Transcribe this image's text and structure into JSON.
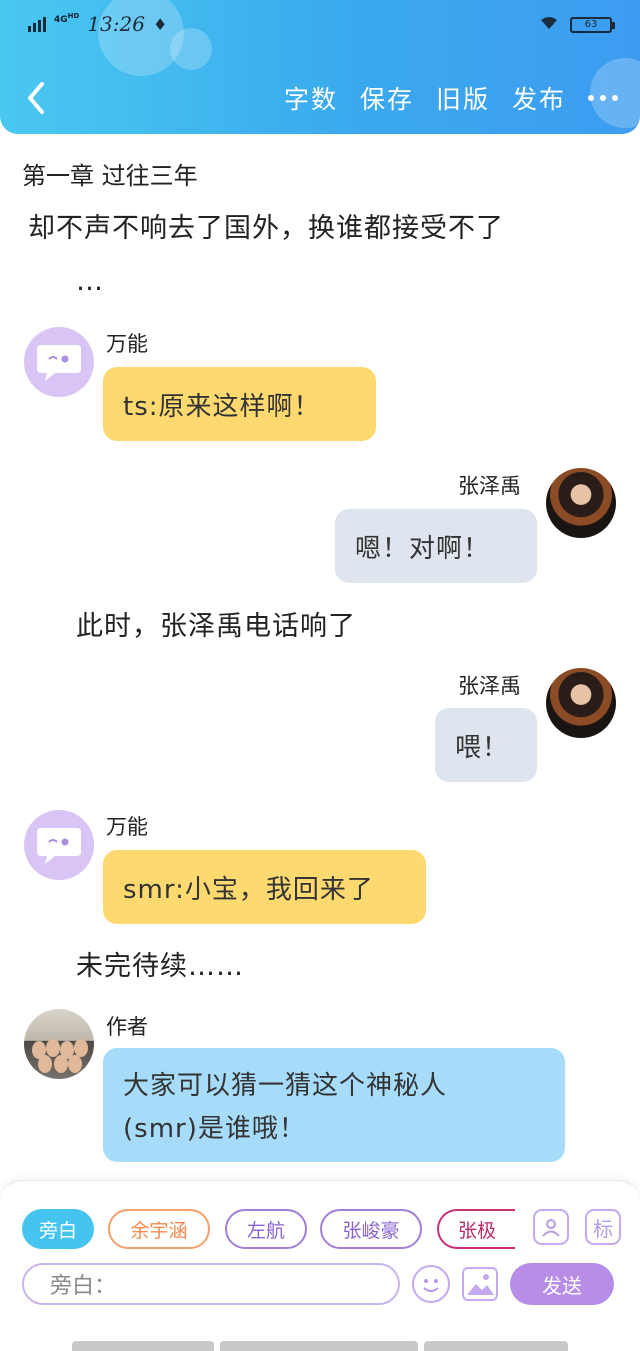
{
  "status": {
    "network": "4G",
    "network_sup": "HD",
    "time": "13:26",
    "wechat_icon": "wechat-icon",
    "battery": "63"
  },
  "toolbar": {
    "word_count": "字数",
    "save": "保存",
    "old_version": "旧版",
    "publish": "发布"
  },
  "story": {
    "chapter_title": "第一章 过往三年",
    "line1": "却不声不响去了国外，换谁都接受不了",
    "line2": "…",
    "line3": "此时，张泽禹电话响了",
    "line4": "未完待续……"
  },
  "messages": {
    "m1": {
      "speaker": "万能",
      "text": "ts:原来这样啊！"
    },
    "m2": {
      "speaker": "张泽禹",
      "text": "嗯！对啊！"
    },
    "m3": {
      "speaker": "张泽禹",
      "text": "喂！"
    },
    "m4": {
      "speaker": "万能",
      "text": "smr:小宝，我回来了"
    },
    "m5": {
      "speaker": "作者",
      "line1": "大家可以猜一猜这个神秘人",
      "line2": "(smr)是谁哦！"
    }
  },
  "roles": {
    "narration": "旁白",
    "role1": "余宇涵",
    "role2": "左航",
    "role3": "张峻豪",
    "role4": "张极",
    "tag_btn": "标"
  },
  "input": {
    "placeholder": "旁白：",
    "send": "发送"
  },
  "colors": {
    "header_start": "#49c8f0",
    "header_end": "#3d9cf0",
    "yellow_bubble": "#fdd970",
    "gray_bubble": "#dfe5ee",
    "blue_bubble": "#a6dbf9",
    "send_button": "#b88de8",
    "active_chip": "#46c4f0"
  }
}
